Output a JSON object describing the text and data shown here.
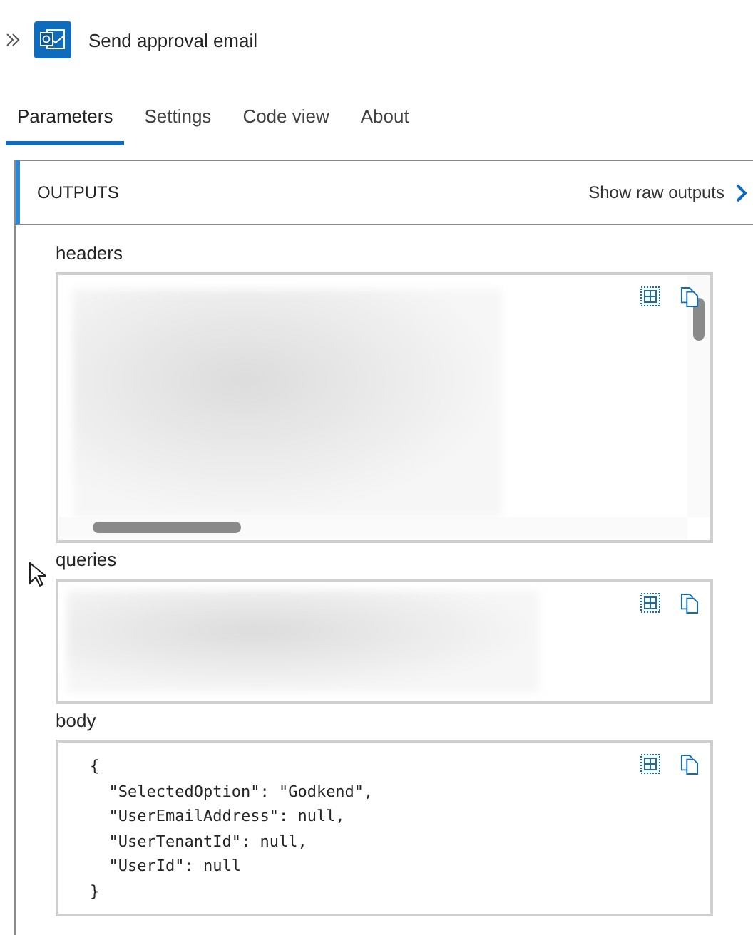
{
  "header": {
    "title": "Send approval email"
  },
  "tabs": [
    {
      "label": "Parameters",
      "selected": true
    },
    {
      "label": "Settings",
      "selected": false
    },
    {
      "label": "Code view",
      "selected": false
    },
    {
      "label": "About",
      "selected": false
    }
  ],
  "outputs": {
    "title": "OUTPUTS",
    "raw_link": "Show raw outputs",
    "fields": [
      {
        "label": "headers",
        "kind": "redacted-scroll"
      },
      {
        "label": "queries",
        "kind": "redacted"
      },
      {
        "label": "body",
        "kind": "code",
        "lines": [
          "{",
          "  \"SelectedOption\": \"Godkend\",",
          "  \"UserEmailAddress\": null,",
          "  \"UserTenantId\": null,",
          "  \"UserId\": null",
          "}"
        ]
      }
    ]
  }
}
